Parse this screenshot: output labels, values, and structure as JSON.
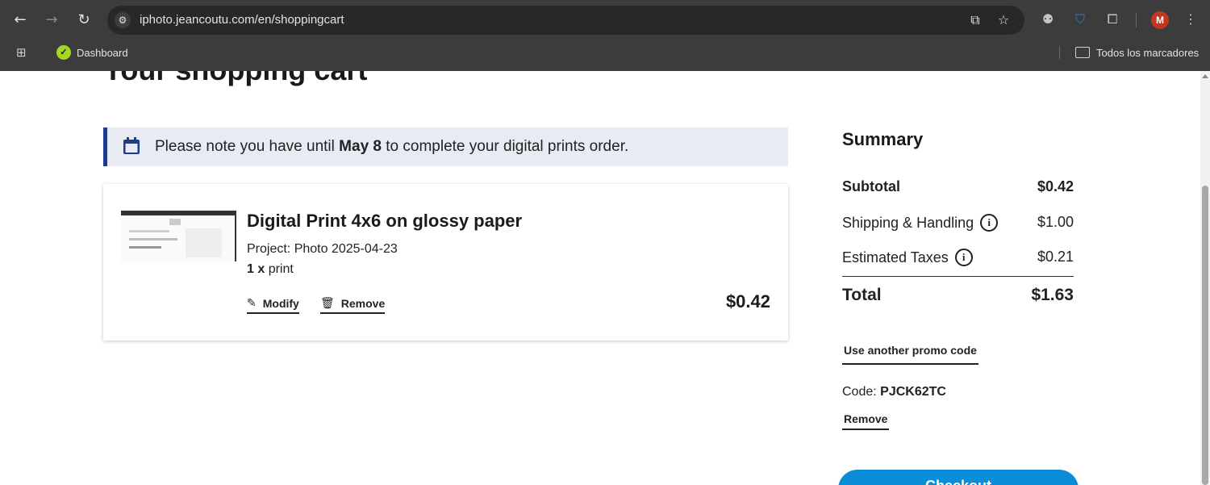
{
  "browser": {
    "url": "iphoto.jeancoutu.com/en/shoppingcart",
    "avatar_letter": "M",
    "bookmarks": {
      "dashboard_label": "Dashboard",
      "all_bookmarks_label": "Todos los marcadores"
    }
  },
  "page": {
    "title": "Your shopping cart",
    "notice": {
      "prefix": "Please note you have until ",
      "date": "May 8",
      "suffix": " to complete your digital prints order."
    },
    "item": {
      "title": "Digital Print 4x6 on glossy paper",
      "project": "Project: Photo 2025-04-23",
      "qty_number": "1 x",
      "qty_unit": " print",
      "modify_label": "Modify",
      "remove_label": "Remove",
      "price": "$0.42"
    },
    "summary": {
      "title": "Summary",
      "subtotal_label": "Subtotal",
      "subtotal_value": "$0.42",
      "shipping_label": "Shipping & Handling",
      "shipping_value": "$1.00",
      "taxes_label": "Estimated Taxes",
      "taxes_value": "$0.21",
      "total_label": "Total",
      "total_value": "$1.63",
      "promo_link": "Use another promo code",
      "code_label": "Code: ",
      "code_value": "PJCK62TC",
      "remove_code_label": "Remove",
      "checkout_label": "Checkout"
    }
  },
  "colors": {
    "accent_blue": "#0a8dd6",
    "notice_bar": "#1f3b8a",
    "notice_bg": "#e9ebf4"
  }
}
